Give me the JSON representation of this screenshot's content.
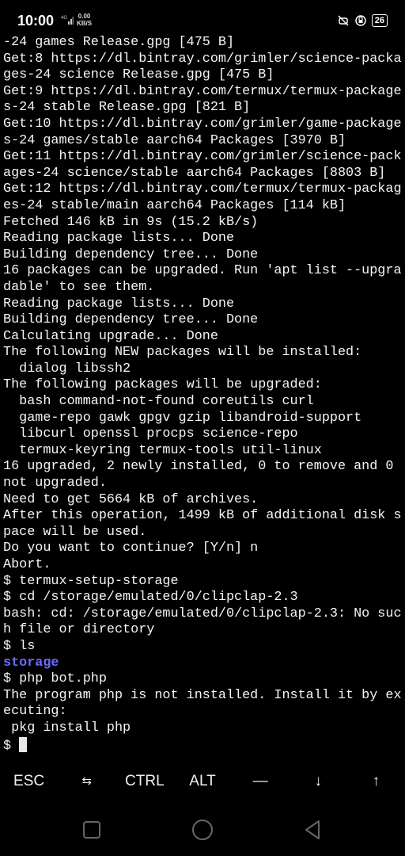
{
  "status_bar": {
    "time": "10:00",
    "network_type": "4G",
    "speed_value": "0.00",
    "speed_unit": "KB/S",
    "battery_level": "26",
    "icons": [
      "signal-icon",
      "mute-icon",
      "alarm-icon",
      "battery-icon"
    ]
  },
  "terminal": {
    "lines": [
      "-24 games Release.gpg [475 B]",
      "Get:8 https://dl.bintray.com/grimler/science-packa",
      "ges-24 science Release.gpg [475 B]",
      "Get:9 https://dl.bintray.com/termux/termux-package",
      "s-24 stable Release.gpg [821 B]",
      "Get:10 https://dl.bintray.com/grimler/game-package",
      "s-24 games/stable aarch64 Packages [3970 B]",
      "Get:11 https://dl.bintray.com/grimler/science-pack",
      "ages-24 science/stable aarch64 Packages [8803 B]",
      "Get:12 https://dl.bintray.com/termux/termux-packag",
      "es-24 stable/main aarch64 Packages [114 kB]",
      "Fetched 146 kB in 9s (15.2 kB/s)",
      "Reading package lists... Done",
      "Building dependency tree... Done",
      "16 packages can be upgraded. Run 'apt list --upgra",
      "dable' to see them.",
      "Reading package lists... Done",
      "Building dependency tree... Done",
      "Calculating upgrade... Done",
      "The following NEW packages will be installed:",
      "  dialog libssh2",
      "The following packages will be upgraded:",
      "  bash command-not-found coreutils curl",
      "  game-repo gawk gpgv gzip libandroid-support",
      "  libcurl openssl procps science-repo",
      "  termux-keyring termux-tools util-linux",
      "16 upgraded, 2 newly installed, 0 to remove and 0",
      "not upgraded.",
      "Need to get 5664 kB of archives.",
      "After this operation, 1499 kB of additional disk s",
      "pace will be used.",
      "Do you want to continue? [Y/n] n",
      "Abort.",
      "$ termux-setup-storage",
      "$ cd /storage/emulated/0/clipclap-2.3",
      "bash: cd: /storage/emulated/0/clipclap-2.3: No suc",
      "h file or directory",
      "$ ls",
      "storage",
      "$ php bot.php",
      "The program php is not installed. Install it by ex",
      "ecuting:",
      " pkg install php"
    ],
    "prompt": "$ ",
    "directory_color": "#6a6aff"
  },
  "extra_keys": [
    {
      "label": "ESC",
      "name": "esc-key"
    },
    {
      "label": "⇆",
      "name": "tab-key"
    },
    {
      "label": "CTRL",
      "name": "ctrl-key"
    },
    {
      "label": "ALT",
      "name": "alt-key"
    },
    {
      "label": "—",
      "name": "dash-key"
    },
    {
      "label": "↓",
      "name": "arrow-down-key"
    },
    {
      "label": "↑",
      "name": "arrow-up-key"
    }
  ],
  "nav_bar": {
    "icons": [
      "recents-icon",
      "home-icon",
      "back-icon"
    ]
  }
}
